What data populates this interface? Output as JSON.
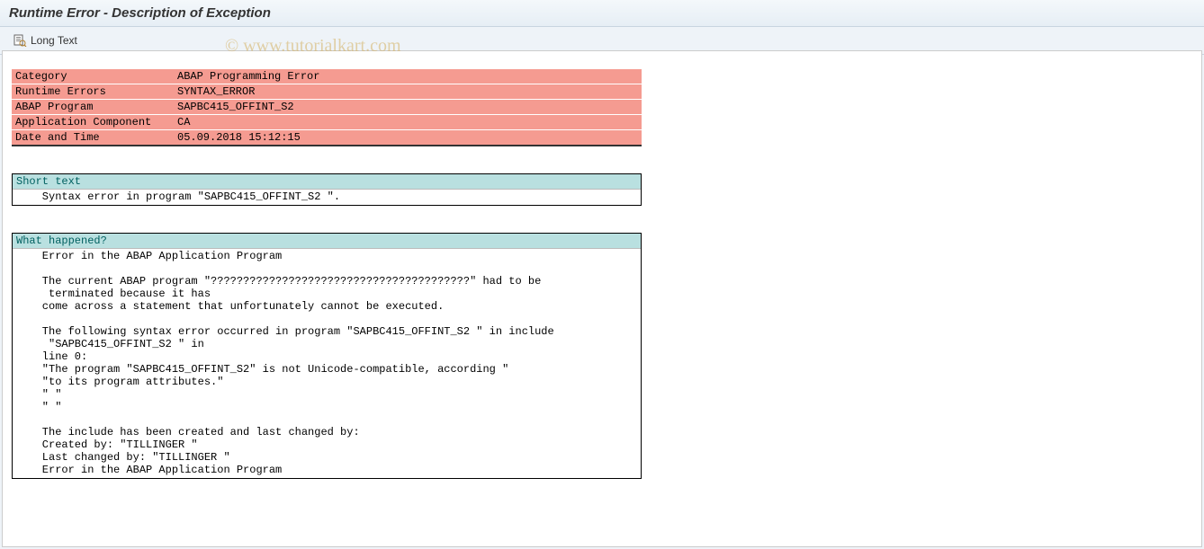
{
  "header": {
    "title": "Runtime Error - Description of Exception"
  },
  "toolbar": {
    "long_text_label": "Long Text"
  },
  "watermark": "© www.tutorialkart.com",
  "summary": {
    "rows": [
      {
        "label": "Category",
        "value": "ABAP Programming Error"
      },
      {
        "label": "Runtime Errors",
        "value": "SYNTAX_ERROR"
      },
      {
        "label": "ABAP Program",
        "value": "SAPBC415_OFFINT_S2"
      },
      {
        "label": "Application Component",
        "value": "CA"
      },
      {
        "label": "Date and Time",
        "value": "05.09.2018 15:12:15"
      }
    ]
  },
  "short_text": {
    "title": "Short text",
    "body": "    Syntax error in program \"SAPBC415_OFFINT_S2 \"."
  },
  "what_happened": {
    "title": "What happened?",
    "body": "    Error in the ABAP Application Program\n\n    The current ABAP program \"????????????????????????????????????????\" had to be\n     terminated because it has\n    come across a statement that unfortunately cannot be executed.\n\n    The following syntax error occurred in program \"SAPBC415_OFFINT_S2 \" in include\n     \"SAPBC415_OFFINT_S2 \" in\n    line 0:\n    \"The program \"SAPBC415_OFFINT_S2\" is not Unicode-compatible, according \"\n    \"to its program attributes.\"\n    \" \"\n    \" \"\n\n    The include has been created and last changed by:\n    Created by: \"TILLINGER \"\n    Last changed by: \"TILLINGER \"\n    Error in the ABAP Application Program"
  }
}
